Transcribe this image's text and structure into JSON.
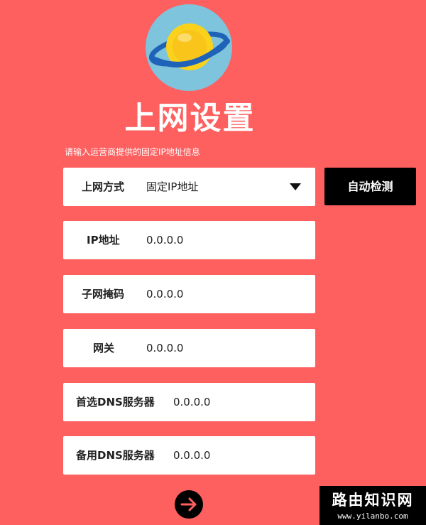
{
  "header": {
    "logo_icon": "planet-icon",
    "title": "上网设置",
    "hint": "请输入运营商提供的固定IP地址信息"
  },
  "form": {
    "connection_type": {
      "label": "上网方式",
      "value": "固定IP地址"
    },
    "ip_address": {
      "label": "IP地址",
      "value": "0.0.0.0"
    },
    "subnet_mask": {
      "label": "子网掩码",
      "value": "0.0.0.0"
    },
    "gateway": {
      "label": "网关",
      "value": "0.0.0.0"
    },
    "primary_dns": {
      "label": "首选DNS服务器",
      "value": "0.0.0.0"
    },
    "secondary_dns": {
      "label": "备用DNS服务器",
      "value": "0.0.0.0"
    }
  },
  "buttons": {
    "auto_detect": "自动检测",
    "next_icon": "arrow-right-icon"
  },
  "watermark": {
    "title": "路由知识网",
    "url": "www.yilanbo.com"
  },
  "colors": {
    "background": "#fe5f5f",
    "field": "#ffffff",
    "button": "#000000",
    "logo_bg": "#7ec4dc",
    "planet": "#fbd21b",
    "ring": "#1f63b8"
  }
}
